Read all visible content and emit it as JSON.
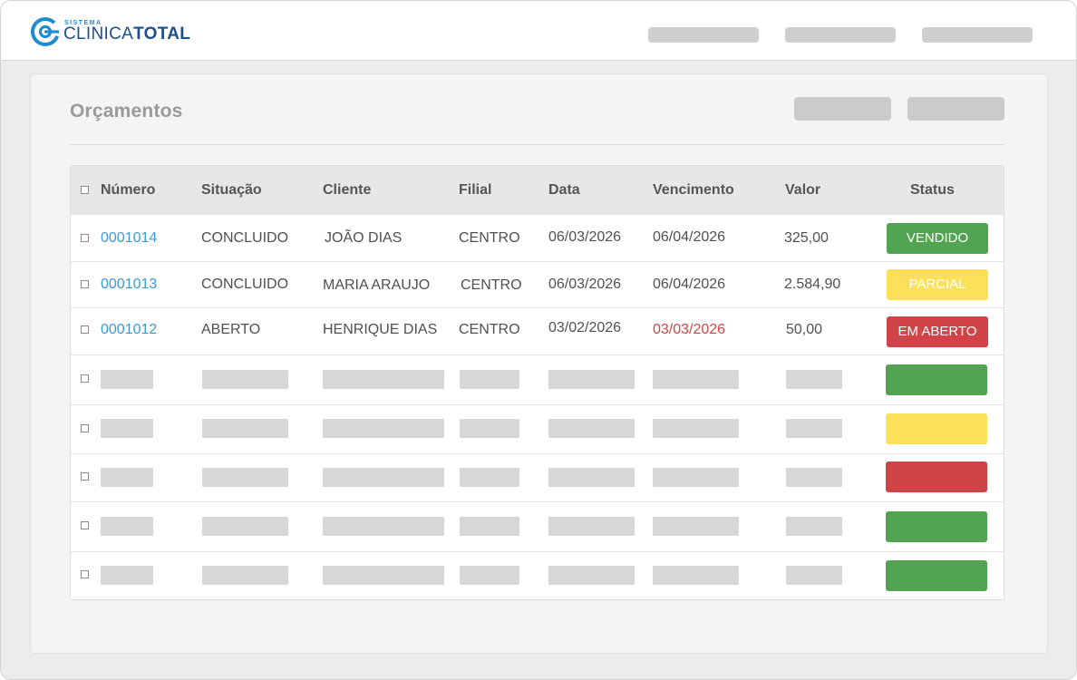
{
  "app": {
    "logo_small": "SISTEMA",
    "logo_light": "CLINICA",
    "logo_bold": "TOTAL",
    "brand_color": "#1d4f8c",
    "accent_color": "#1d8dd1"
  },
  "page": {
    "title": "Orçamentos"
  },
  "table": {
    "columns": [
      "Número",
      "Situação",
      "Cliente",
      "Filial",
      "Data",
      "Vencimento",
      "Valor",
      "Status"
    ],
    "rows": [
      {
        "numero": "0001014",
        "situacao": "CONCLUIDO",
        "cliente": "JOÃO DIAS",
        "filial": "CENTRO",
        "data": "06/03/2026",
        "vencimento": "06/04/2026",
        "vencimento_overdue": false,
        "valor": "325,00",
        "status": "VENDIDO",
        "status_color": "#52a452"
      },
      {
        "numero": "0001013",
        "situacao": "CONCLUIDO",
        "cliente": "MARIA ARAUJO",
        "filial": "CENTRO",
        "data": "06/03/2026",
        "vencimento": "06/04/2026",
        "vencimento_overdue": false,
        "valor": "2.584,90",
        "status": "PARCIAL",
        "status_color": "#fde05a"
      },
      {
        "numero": "0001012",
        "situacao": "ABERTO",
        "cliente": "HENRIQUE DIAS",
        "filial": "CENTRO",
        "data": "03/02/2026",
        "vencimento": "03/03/2026",
        "vencimento_overdue": true,
        "valor": "50,00",
        "status": "EM ABERTO",
        "status_color": "#d04448"
      }
    ],
    "placeholder_row_status_colors": [
      "#52a452",
      "#fde05a",
      "#d04448",
      "#52a452",
      "#52a452"
    ]
  }
}
